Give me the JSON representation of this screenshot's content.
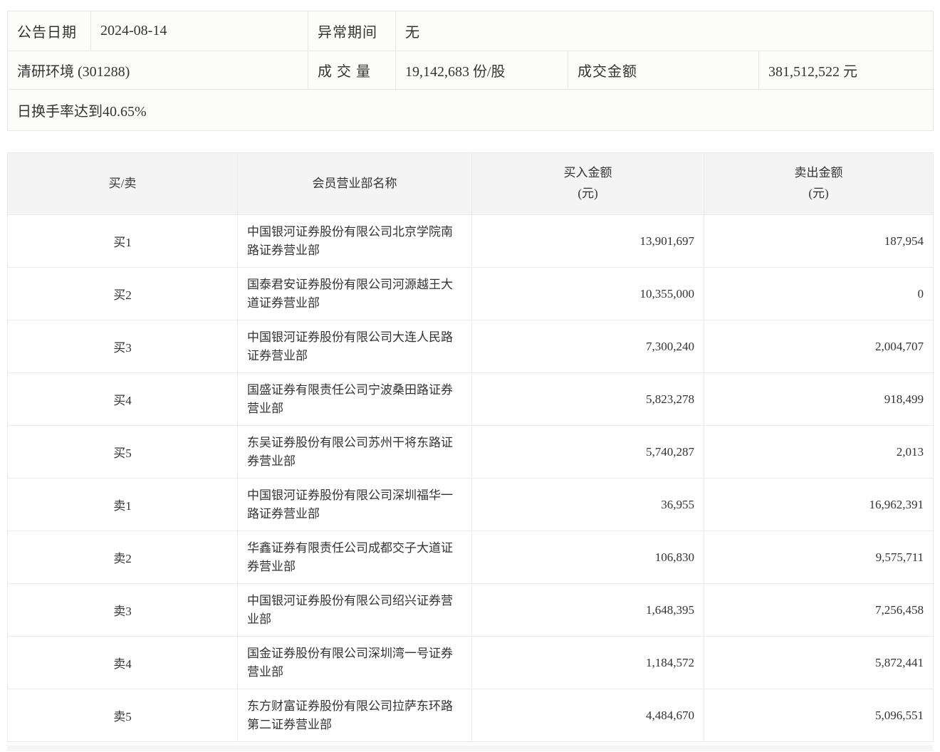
{
  "colors": {
    "border": "#e8e8e8",
    "table_border": "#ebebeb",
    "header_bg": "#f4f4f4",
    "info_bg": "#fcfcfa",
    "text": "#333333"
  },
  "info": {
    "announce_date_label": "公告日期",
    "announce_date": "2024-08-14",
    "abnormal_period_label": "异常期间",
    "abnormal_period": "无",
    "stock_name": "清研环境 (301288)",
    "volume_label": "成 交 量",
    "volume": "19,142,683 份/股",
    "turnover_label": "成交金额",
    "turnover": "381,512,522 元",
    "note": "日换手率达到40.65%"
  },
  "table": {
    "headers": {
      "side": "买/卖",
      "broker": "会员营业部名称",
      "buy_line1": "买入金额",
      "buy_line2": "(元)",
      "sell_line1": "卖出金额",
      "sell_line2": "(元)"
    },
    "rows": [
      {
        "side": "买1",
        "broker": "中国银河证券股份有限公司北京学院南路证券营业部",
        "buy": "13,901,697",
        "sell": "187,954"
      },
      {
        "side": "买2",
        "broker": "国泰君安证券股份有限公司河源越王大道证券营业部",
        "buy": "10,355,000",
        "sell": "0"
      },
      {
        "side": "买3",
        "broker": "中国银河证券股份有限公司大连人民路证券营业部",
        "buy": "7,300,240",
        "sell": "2,004,707"
      },
      {
        "side": "买4",
        "broker": "国盛证券有限责任公司宁波桑田路证券营业部",
        "buy": "5,823,278",
        "sell": "918,499"
      },
      {
        "side": "买5",
        "broker": "东吴证券股份有限公司苏州干将东路证券营业部",
        "buy": "5,740,287",
        "sell": "2,013"
      },
      {
        "side": "卖1",
        "broker": "中国银河证券股份有限公司深圳福华一路证券营业部",
        "buy": "36,955",
        "sell": "16,962,391"
      },
      {
        "side": "卖2",
        "broker": "华鑫证券有限责任公司成都交子大道证券营业部",
        "buy": "106,830",
        "sell": "9,575,711"
      },
      {
        "side": "卖3",
        "broker": "中国银河证券股份有限公司绍兴证券营业部",
        "buy": "1,648,395",
        "sell": "7,256,458"
      },
      {
        "side": "卖4",
        "broker": "国金证券股份有限公司深圳湾一号证券营业部",
        "buy": "1,184,572",
        "sell": "5,872,441"
      },
      {
        "side": "卖5",
        "broker": "东方财富证券股份有限公司拉萨东环路第二证券营业部",
        "buy": "4,484,670",
        "sell": "5,096,551"
      }
    ]
  }
}
